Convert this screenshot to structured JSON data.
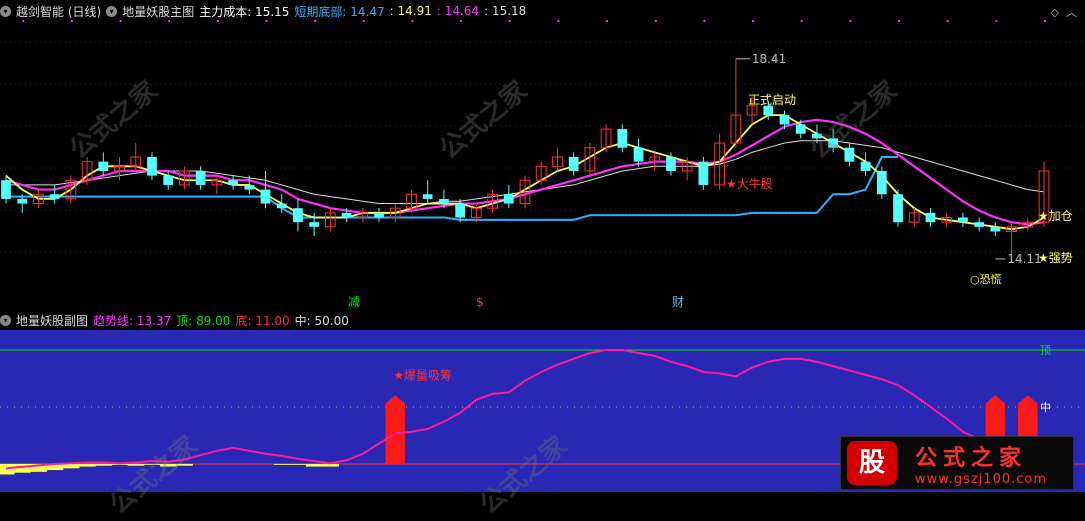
{
  "main_header": {
    "title": "越剑智能 (日线)",
    "indicator": "地量妖股主图",
    "cost_label": "主力成本: 15.15",
    "bottom_label": "短期底部: 14.47",
    "v2": ": 14.91",
    "v3": ": 14.64",
    "v4": ": 15.18"
  },
  "sub_header": {
    "indicator": "地量妖股副图",
    "trend": "趋势线: 13.37",
    "top": "顶: 89.00",
    "bottom": "底: 11.00",
    "mid": "中: 50.00"
  },
  "colors": {
    "up": "#ff3232",
    "down": "#54ffff",
    "yellow": "#ffff54",
    "magenta": "#ff30ff",
    "white": "#dcdcdc",
    "cyan_line": "#2ab4ff",
    "sub_bg": "#2828b4",
    "header_cost": "#ffffff",
    "header_bottom": "#2ab4ff"
  },
  "annotations": {
    "high": "18.41",
    "low": "14.11",
    "start": "正式启动",
    "bull": "★大牛股",
    "add": "★加仓",
    "strong": "★强势",
    "panic": "○恐慌",
    "reduce": "减",
    "dollar": "$",
    "wealth": "财",
    "absorb": "★爆量吸筹",
    "top_mark": "顶",
    "mid_mark": "中"
  },
  "logo": {
    "badge": "股",
    "title": "公式之家",
    "url": "www.gszj100.com"
  },
  "watermark": "公式之家",
  "chart_data": {
    "type": "candlestick",
    "ylim": [
      13.4,
      19.2
    ],
    "candles": [
      {
        "o": 15.8,
        "h": 15.9,
        "l": 15.3,
        "c": 15.4
      },
      {
        "o": 15.4,
        "h": 15.5,
        "l": 15.1,
        "c": 15.3
      },
      {
        "o": 15.3,
        "h": 15.6,
        "l": 15.2,
        "c": 15.5
      },
      {
        "o": 15.5,
        "h": 15.7,
        "l": 15.3,
        "c": 15.4
      },
      {
        "o": 15.4,
        "h": 15.9,
        "l": 15.3,
        "c": 15.8
      },
      {
        "o": 15.8,
        "h": 16.3,
        "l": 15.7,
        "c": 16.2
      },
      {
        "o": 16.2,
        "h": 16.4,
        "l": 15.9,
        "c": 16.0
      },
      {
        "o": 16.0,
        "h": 16.3,
        "l": 15.8,
        "c": 16.1
      },
      {
        "o": 16.1,
        "h": 16.6,
        "l": 16.0,
        "c": 16.3
      },
      {
        "o": 16.3,
        "h": 16.4,
        "l": 15.8,
        "c": 15.9
      },
      {
        "o": 15.9,
        "h": 16.0,
        "l": 15.6,
        "c": 15.7
      },
      {
        "o": 15.7,
        "h": 16.1,
        "l": 15.6,
        "c": 16.0
      },
      {
        "o": 16.0,
        "h": 16.1,
        "l": 15.6,
        "c": 15.7
      },
      {
        "o": 15.7,
        "h": 15.9,
        "l": 15.5,
        "c": 15.8
      },
      {
        "o": 15.8,
        "h": 15.9,
        "l": 15.6,
        "c": 15.7
      },
      {
        "o": 15.7,
        "h": 15.9,
        "l": 15.5,
        "c": 15.6
      },
      {
        "o": 15.6,
        "h": 16.0,
        "l": 15.2,
        "c": 15.3
      },
      {
        "o": 15.3,
        "h": 15.5,
        "l": 15.1,
        "c": 15.2
      },
      {
        "o": 15.2,
        "h": 15.4,
        "l": 14.7,
        "c": 14.9
      },
      {
        "o": 14.9,
        "h": 15.1,
        "l": 14.6,
        "c": 14.8
      },
      {
        "o": 14.8,
        "h": 15.2,
        "l": 14.7,
        "c": 15.1
      },
      {
        "o": 15.1,
        "h": 15.2,
        "l": 14.9,
        "c": 15.0
      },
      {
        "o": 15.0,
        "h": 15.2,
        "l": 14.9,
        "c": 15.1
      },
      {
        "o": 15.1,
        "h": 15.2,
        "l": 14.9,
        "c": 15.0
      },
      {
        "o": 15.0,
        "h": 15.3,
        "l": 14.9,
        "c": 15.2
      },
      {
        "o": 15.2,
        "h": 15.6,
        "l": 15.1,
        "c": 15.5
      },
      {
        "o": 15.5,
        "h": 15.8,
        "l": 15.3,
        "c": 15.4
      },
      {
        "o": 15.4,
        "h": 15.6,
        "l": 15.2,
        "c": 15.3
      },
      {
        "o": 15.3,
        "h": 15.4,
        "l": 14.9,
        "c": 15.0
      },
      {
        "o": 15.0,
        "h": 15.3,
        "l": 14.9,
        "c": 15.2
      },
      {
        "o": 15.2,
        "h": 15.6,
        "l": 15.1,
        "c": 15.5
      },
      {
        "o": 15.5,
        "h": 15.7,
        "l": 15.2,
        "c": 15.3
      },
      {
        "o": 15.3,
        "h": 15.9,
        "l": 15.2,
        "c": 15.8
      },
      {
        "o": 15.8,
        "h": 16.2,
        "l": 15.7,
        "c": 16.1
      },
      {
        "o": 16.1,
        "h": 16.5,
        "l": 16.0,
        "c": 16.3
      },
      {
        "o": 16.3,
        "h": 16.4,
        "l": 15.9,
        "c": 16.0
      },
      {
        "o": 16.0,
        "h": 16.6,
        "l": 15.9,
        "c": 16.5
      },
      {
        "o": 16.5,
        "h": 17.0,
        "l": 16.4,
        "c": 16.9
      },
      {
        "o": 16.9,
        "h": 17.0,
        "l": 16.4,
        "c": 16.5
      },
      {
        "o": 16.5,
        "h": 16.7,
        "l": 16.1,
        "c": 16.2
      },
      {
        "o": 16.2,
        "h": 16.4,
        "l": 16.0,
        "c": 16.3
      },
      {
        "o": 16.3,
        "h": 16.4,
        "l": 15.9,
        "c": 16.0
      },
      {
        "o": 16.0,
        "h": 16.3,
        "l": 15.8,
        "c": 16.2
      },
      {
        "o": 16.2,
        "h": 16.3,
        "l": 15.6,
        "c": 15.7
      },
      {
        "o": 15.7,
        "h": 16.8,
        "l": 15.6,
        "c": 16.6
      },
      {
        "o": 16.6,
        "h": 18.41,
        "l": 16.5,
        "c": 17.2
      },
      {
        "o": 17.2,
        "h": 17.6,
        "l": 17.0,
        "c": 17.4
      },
      {
        "o": 17.4,
        "h": 17.5,
        "l": 17.1,
        "c": 17.2
      },
      {
        "o": 17.2,
        "h": 17.3,
        "l": 16.9,
        "c": 17.0
      },
      {
        "o": 17.0,
        "h": 17.1,
        "l": 16.7,
        "c": 16.8
      },
      {
        "o": 16.8,
        "h": 17.0,
        "l": 16.6,
        "c": 16.7
      },
      {
        "o": 16.7,
        "h": 16.9,
        "l": 16.4,
        "c": 16.5
      },
      {
        "o": 16.5,
        "h": 16.6,
        "l": 16.1,
        "c": 16.2
      },
      {
        "o": 16.2,
        "h": 16.4,
        "l": 15.9,
        "c": 16.0
      },
      {
        "o": 16.0,
        "h": 16.1,
        "l": 15.4,
        "c": 15.5
      },
      {
        "o": 15.5,
        "h": 15.6,
        "l": 14.8,
        "c": 14.9
      },
      {
        "o": 14.9,
        "h": 15.2,
        "l": 14.8,
        "c": 15.1
      },
      {
        "o": 15.1,
        "h": 15.2,
        "l": 14.8,
        "c": 14.9
      },
      {
        "o": 14.9,
        "h": 15.1,
        "l": 14.8,
        "c": 15.0
      },
      {
        "o": 15.0,
        "h": 15.1,
        "l": 14.8,
        "c": 14.9
      },
      {
        "o": 14.9,
        "h": 15.0,
        "l": 14.7,
        "c": 14.8
      },
      {
        "o": 14.8,
        "h": 14.9,
        "l": 14.6,
        "c": 14.7
      },
      {
        "o": 14.7,
        "h": 14.9,
        "l": 14.11,
        "c": 14.8
      },
      {
        "o": 14.8,
        "h": 15.0,
        "l": 14.7,
        "c": 14.9
      },
      {
        "o": 14.9,
        "h": 16.2,
        "l": 14.8,
        "c": 16.0
      }
    ],
    "ma_yellow": [
      15.9,
      15.6,
      15.4,
      15.4,
      15.6,
      15.9,
      16.1,
      16.1,
      16.1,
      16.0,
      15.9,
      15.8,
      15.8,
      15.8,
      15.7,
      15.7,
      15.5,
      15.3,
      15.1,
      15.0,
      15.0,
      15.0,
      15.1,
      15.1,
      15.1,
      15.2,
      15.3,
      15.3,
      15.3,
      15.2,
      15.3,
      15.4,
      15.6,
      15.8,
      16.0,
      16.1,
      16.3,
      16.5,
      16.6,
      16.5,
      16.4,
      16.3,
      16.2,
      16.1,
      16.2,
      16.6,
      17.0,
      17.2,
      17.2,
      17.0,
      16.8,
      16.6,
      16.4,
      16.2,
      15.9,
      15.5,
      15.2,
      15.0,
      14.95,
      14.9,
      14.85,
      14.8,
      14.75,
      14.8,
      15.0
    ],
    "ma_magenta": [
      15.8,
      15.7,
      15.6,
      15.6,
      15.7,
      15.8,
      15.9,
      16.0,
      16.0,
      16.0,
      16.0,
      15.9,
      15.9,
      15.9,
      15.8,
      15.8,
      15.7,
      15.6,
      15.4,
      15.3,
      15.2,
      15.15,
      15.1,
      15.1,
      15.1,
      15.15,
      15.2,
      15.25,
      15.3,
      15.3,
      15.35,
      15.4,
      15.5,
      15.6,
      15.7,
      15.8,
      15.9,
      16.0,
      16.1,
      16.15,
      16.2,
      16.2,
      16.2,
      16.15,
      16.2,
      16.35,
      16.55,
      16.75,
      16.95,
      17.05,
      17.1,
      17.05,
      16.95,
      16.8,
      16.6,
      16.35,
      16.1,
      15.85,
      15.6,
      15.35,
      15.15,
      15.0,
      14.9,
      14.85,
      14.9
    ],
    "ma_white": [
      15.7,
      15.7,
      15.7,
      15.7,
      15.75,
      15.8,
      15.85,
      15.9,
      15.95,
      16.0,
      16.0,
      16.0,
      16.0,
      15.95,
      15.9,
      15.85,
      15.8,
      15.7,
      15.6,
      15.5,
      15.45,
      15.4,
      15.35,
      15.3,
      15.3,
      15.3,
      15.3,
      15.35,
      15.35,
      15.4,
      15.45,
      15.5,
      15.55,
      15.6,
      15.65,
      15.7,
      15.8,
      15.9,
      16.0,
      16.05,
      16.1,
      16.1,
      16.1,
      16.1,
      16.15,
      16.25,
      16.4,
      16.5,
      16.6,
      16.65,
      16.65,
      16.65,
      16.6,
      16.55,
      16.5,
      16.4,
      16.3,
      16.2,
      16.1,
      16.0,
      15.9,
      15.8,
      15.7,
      15.6,
      15.55
    ],
    "support_line": [
      15.45,
      15.45,
      15.45,
      15.45,
      15.45,
      15.45,
      15.45,
      15.45,
      15.45,
      15.45,
      15.45,
      15.45,
      15.45,
      15.45,
      15.45,
      15.45,
      15.45,
      15.2,
      15.0,
      15.0,
      15.0,
      15.0,
      15.0,
      15.0,
      15.0,
      15.0,
      15.0,
      15.0,
      14.95,
      14.95,
      14.95,
      14.95,
      14.95,
      14.95,
      14.95,
      14.95,
      15.05,
      15.05,
      15.05,
      15.05,
      15.05,
      15.05,
      15.05,
      15.05,
      15.05,
      15.05,
      15.1,
      15.1,
      15.1,
      15.1,
      15.1,
      15.5,
      15.5,
      15.6,
      16.3,
      16.3,
      null,
      null,
      null,
      null,
      null,
      null,
      null,
      null,
      null
    ],
    "sub_trend": [
      8,
      9,
      10,
      11,
      11.5,
      12,
      12,
      11.5,
      12,
      13,
      12.5,
      14,
      17,
      20,
      22,
      20,
      18,
      16.5,
      14.5,
      13,
      11.5,
      13.5,
      18,
      25,
      32,
      33,
      35,
      40,
      46,
      55,
      59,
      60,
      68,
      74,
      79,
      83,
      87,
      89,
      89,
      87,
      85,
      81,
      78,
      74,
      73,
      71,
      77,
      81,
      83,
      83,
      81,
      78,
      75,
      72,
      69,
      65,
      58,
      50,
      42,
      33,
      28,
      26,
      22,
      18,
      16
    ],
    "sub_yellow_bars": [
      -12,
      -10,
      -9,
      -7,
      -5,
      -3,
      -2,
      -1,
      -2,
      -1,
      -3,
      -2,
      0,
      0,
      0,
      0,
      0,
      -1,
      -1,
      -3,
      -3,
      0,
      0,
      0,
      0,
      0,
      0,
      0,
      0,
      0,
      0,
      0,
      0,
      0,
      0,
      0,
      0,
      0,
      0,
      0,
      0,
      0,
      0,
      0,
      0,
      0,
      0,
      0,
      0,
      0,
      0,
      0,
      0,
      0,
      0,
      0,
      0,
      0,
      0,
      0,
      0,
      0,
      0,
      0,
      0
    ],
    "sub_red_spikes": [
      {
        "i": 24,
        "v": 58
      },
      {
        "i": 61,
        "v": 58
      },
      {
        "i": 63,
        "v": 58
      }
    ],
    "sub_ylim": [
      0,
      100
    ],
    "sub_levels": {
      "top": 89,
      "bottom": 11,
      "mid": 50
    }
  }
}
